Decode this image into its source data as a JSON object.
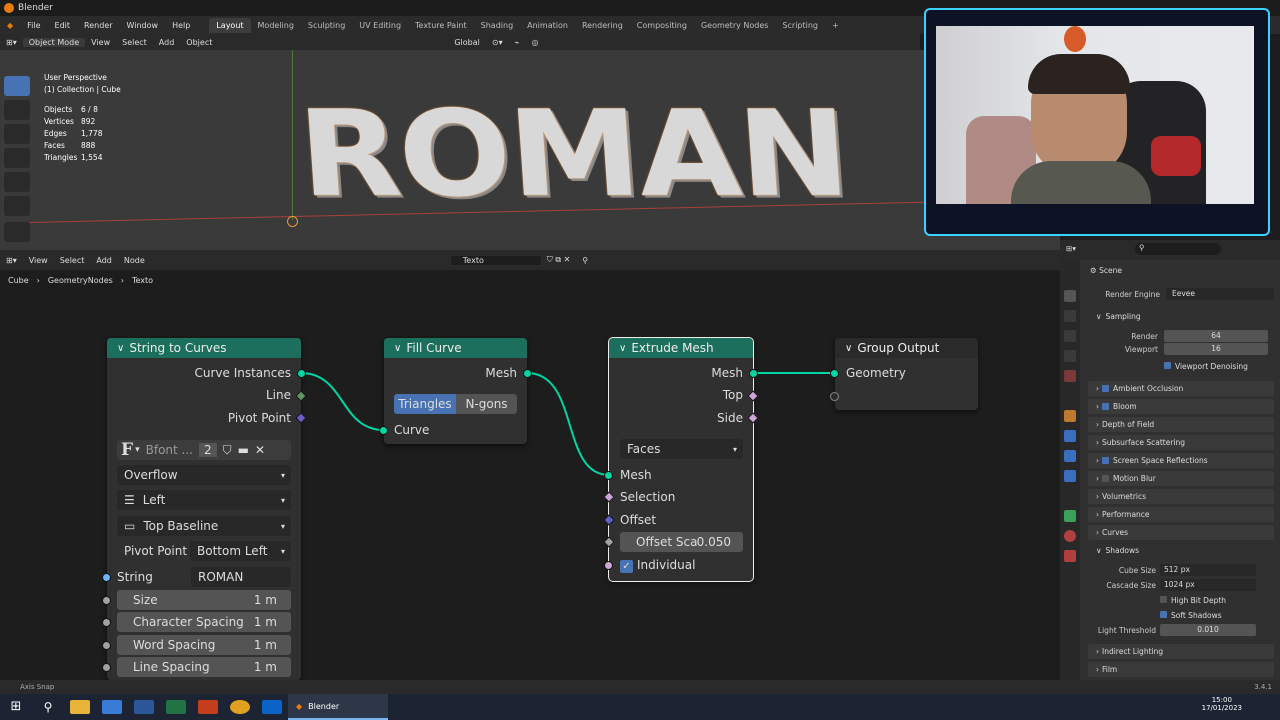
{
  "window": {
    "title": "Blender"
  },
  "menu": [
    "File",
    "Edit",
    "Render",
    "Window",
    "Help"
  ],
  "workspaces": [
    "Layout",
    "Modeling",
    "Sculpting",
    "UV Editing",
    "Texture Paint",
    "Shading",
    "Animation",
    "Rendering",
    "Compositing",
    "Geometry Nodes",
    "Scripting"
  ],
  "active_workspace": "Layout",
  "viewport_header": {
    "mode": "Object Mode",
    "menus": [
      "View",
      "Select",
      "Add",
      "Object"
    ],
    "orientation": "Global"
  },
  "viewport": {
    "perspective": "User Perspective",
    "collection": "(1) Collection | Cube",
    "stats": [
      {
        "label": "Objects",
        "value": "6 / 8"
      },
      {
        "label": "Vertices",
        "value": "892"
      },
      {
        "label": "Edges",
        "value": "1,778"
      },
      {
        "label": "Faces",
        "value": "888"
      },
      {
        "label": "Triangles",
        "value": "1,554"
      }
    ],
    "text_3d": "ROMAN"
  },
  "node_editor_header": {
    "menus": [
      "View",
      "Select",
      "Add",
      "Node"
    ],
    "tree_name": "Texto"
  },
  "breadcrumb": [
    "Cube",
    "GeometryNodes",
    "Texto"
  ],
  "nodes": {
    "string_to_curves": {
      "title": "String to Curves",
      "outputs": [
        "Curve Instances",
        "Line",
        "Pivot Point"
      ],
      "font_name": "Bfont ...",
      "font_users": "2",
      "overflow": "Overflow",
      "align_x": "Left",
      "align_y": "Top Baseline",
      "pivot_label": "Pivot Point",
      "pivot_value": "Bottom Left",
      "string_label": "String",
      "string_value": "ROMAN",
      "fields": [
        {
          "label": "Size",
          "value": "1 m"
        },
        {
          "label": "Character Spacing",
          "value": "1 m"
        },
        {
          "label": "Word Spacing",
          "value": "1 m"
        },
        {
          "label": "Line Spacing",
          "value": "1 m"
        }
      ]
    },
    "fill_curve": {
      "title": "Fill Curve",
      "output": "Mesh",
      "mode_options": [
        "Triangles",
        "N-gons"
      ],
      "mode_selected": "Triangles",
      "input": "Curve"
    },
    "extrude_mesh": {
      "title": "Extrude Mesh",
      "outputs": [
        "Mesh",
        "Top",
        "Side"
      ],
      "mode": "Faces",
      "inputs": [
        "Mesh",
        "Selection",
        "Offset"
      ],
      "offset_scale_label": "Offset Sca",
      "offset_scale_value": "0.050",
      "individual_label": "Individual",
      "individual_checked": true
    },
    "group_output": {
      "title": "Group Output",
      "input": "Geometry"
    }
  },
  "properties": {
    "scene_label": "Scene",
    "render_engine_label": "Render Engine",
    "render_engine": "Eevee",
    "sampling": {
      "title": "Sampling",
      "render_label": "Render",
      "render": "64",
      "viewport_label": "Viewport",
      "viewport": "16",
      "denoise_label": "Viewport Denoising"
    },
    "panels": [
      {
        "label": "Ambient Occlusion",
        "check": true
      },
      {
        "label": "Bloom",
        "check": true
      },
      {
        "label": "Depth of Field",
        "check": null
      },
      {
        "label": "Subsurface Scattering",
        "check": null
      },
      {
        "label": "Screen Space Reflections",
        "check": true
      },
      {
        "label": "Motion Blur",
        "check": false
      },
      {
        "label": "Volumetrics",
        "check": null
      },
      {
        "label": "Performance",
        "check": null
      },
      {
        "label": "Curves",
        "check": null
      }
    ],
    "shadows": {
      "title": "Shadows",
      "cube_size_label": "Cube Size",
      "cube_size": "512 px",
      "cascade_size_label": "Cascade Size",
      "cascade_size": "1024 px",
      "high_bit_label": "High Bit Depth",
      "soft_label": "Soft Shadows",
      "light_threshold_label": "Light Threshold",
      "light_threshold": "0.010"
    },
    "more_panels": [
      "Indirect Lighting",
      "Film"
    ]
  },
  "status": {
    "left": "Axis Snap",
    "version": "3.4.1"
  },
  "taskbar": {
    "app": "Blender",
    "time": "15:00",
    "date": "17/01/2023"
  },
  "colors": {
    "accent": "#4772b3",
    "node_header": "#1b6f5c",
    "geometry_socket": "#00d6a3",
    "bg": "#1d1d1d"
  }
}
